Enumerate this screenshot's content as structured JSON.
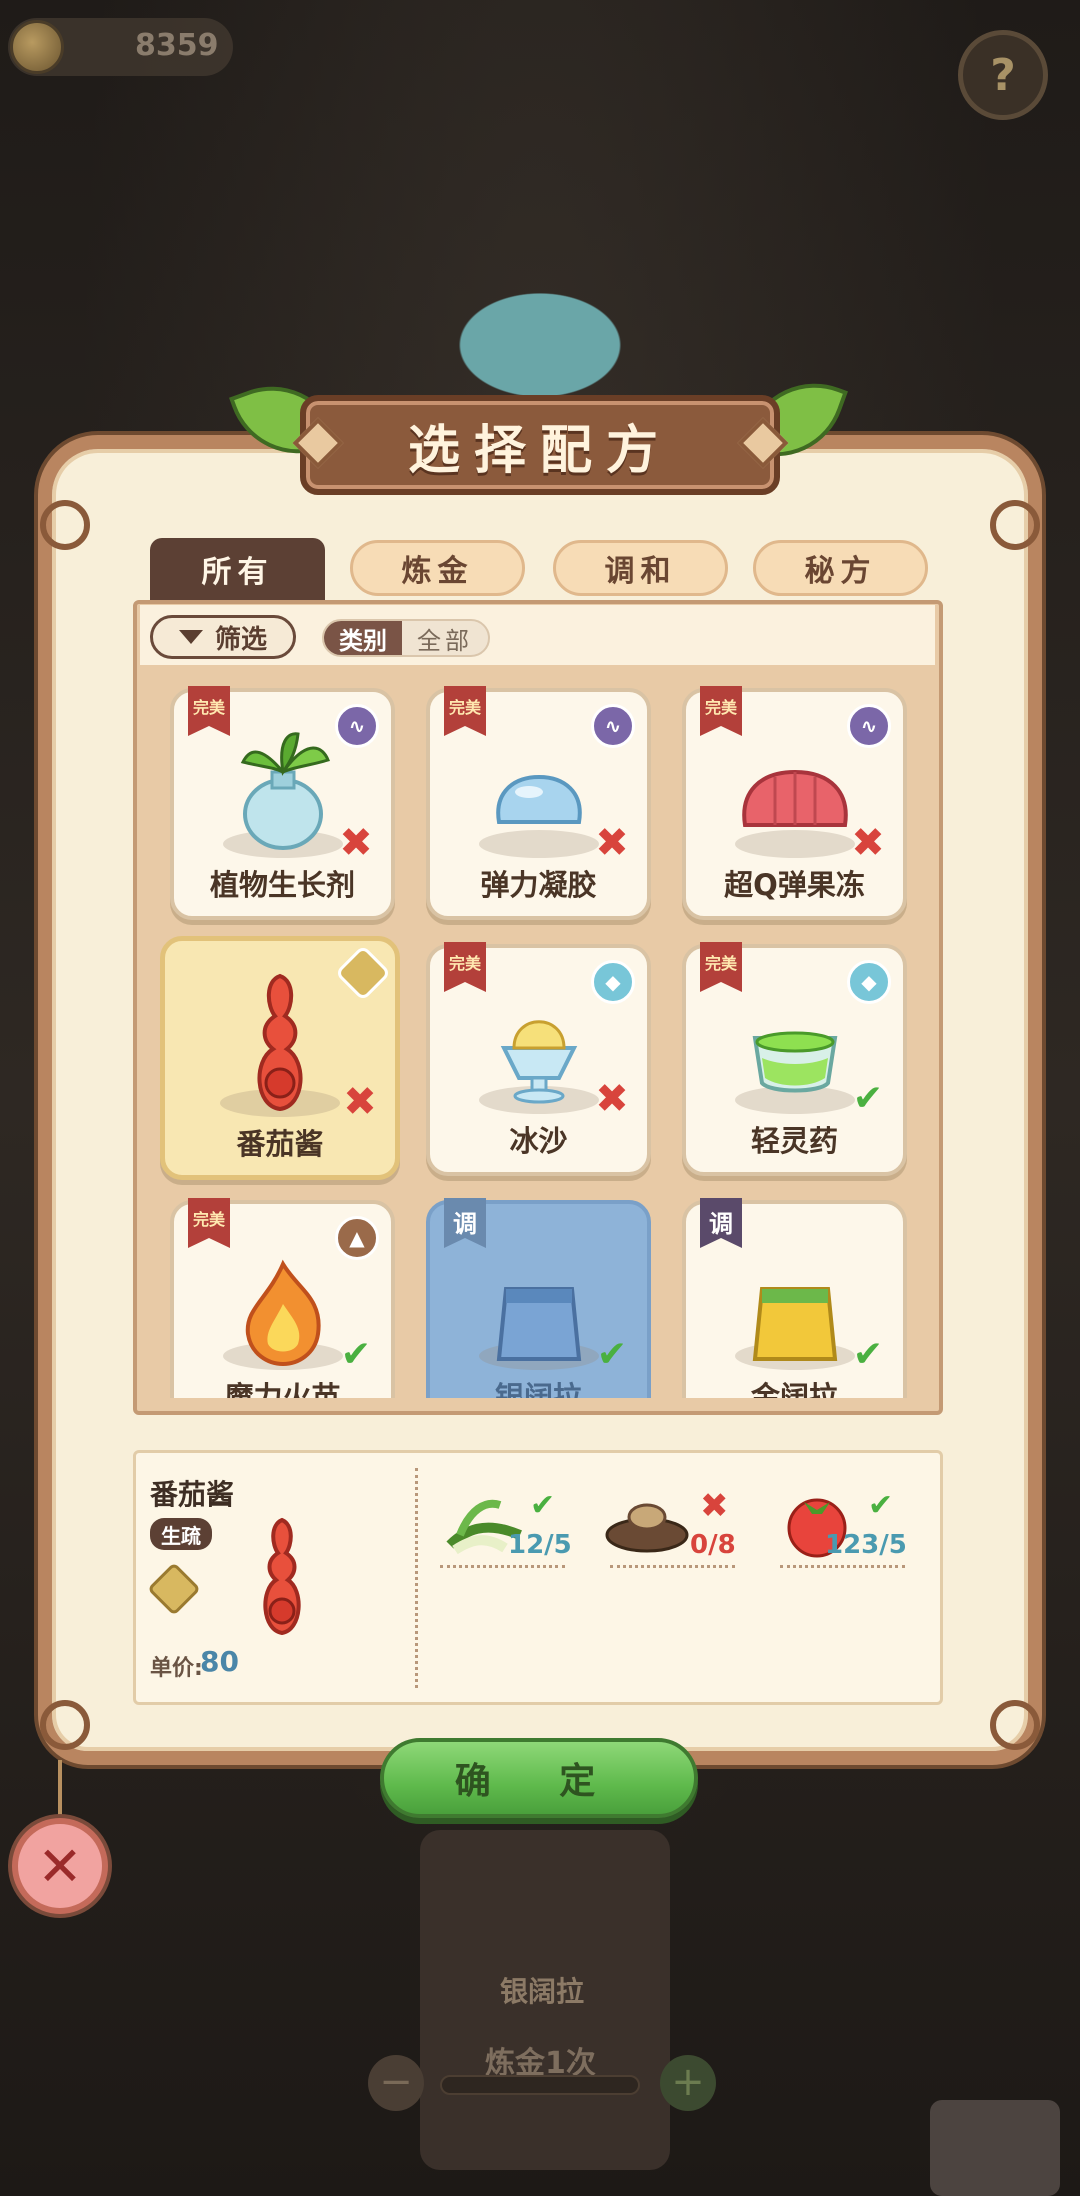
{
  "hud": {
    "coins": "8359",
    "help_icon": "?"
  },
  "panel": {
    "title": "选择配方",
    "tabs": [
      {
        "label": "所有",
        "active": true
      },
      {
        "label": "炼金",
        "active": false
      },
      {
        "label": "调和",
        "active": false
      },
      {
        "label": "秘方",
        "active": false
      }
    ],
    "filter_label": "筛选",
    "category_label": "类别",
    "category_value": "全部"
  },
  "recipes": [
    {
      "name": "植物生长剂",
      "tag": "完美",
      "element": "purple",
      "owned": false
    },
    {
      "name": "弹力凝胶",
      "tag": "完美",
      "element": "purple",
      "owned": false
    },
    {
      "name": "超Q弹果冻",
      "tag": "完美",
      "element": "purple",
      "owned": false
    },
    {
      "name": "番茄酱",
      "tag": "",
      "element": "gold",
      "owned": false,
      "selected": true
    },
    {
      "name": "冰沙",
      "tag": "完美",
      "element": "cyan",
      "owned": false
    },
    {
      "name": "轻灵药",
      "tag": "完美",
      "element": "cyan",
      "owned": true
    },
    {
      "name": "魔力火苗",
      "tag": "完美",
      "element": "brown",
      "owned": true
    },
    {
      "name": "银阔拉",
      "tag": "调",
      "element": "",
      "owned": true,
      "highlight": true
    },
    {
      "name": "金阔拉",
      "tag": "调",
      "element": "",
      "owned": true
    }
  ],
  "detail": {
    "name": "番茄酱",
    "category": "生疏",
    "price_label": "单价:",
    "price": "80",
    "ingredients": [
      {
        "name": "leek",
        "count": "12/5",
        "enough": true
      },
      {
        "name": "mushroom",
        "count": "0/8",
        "enough": false
      },
      {
        "name": "tomato",
        "count": "123/5",
        "enough": true
      }
    ]
  },
  "confirm_label": "确 定",
  "background": {
    "machine_label": "银阔拉",
    "count_label": "炼金1次",
    "minus": "−",
    "plus": "+"
  },
  "colors": {
    "panel_bg": "#f8efd9",
    "panel_border": "#b98560",
    "tab_active": "#5c4034",
    "confirm_green": "#5fba4c",
    "status_bad": "#d8443c",
    "status_ok": "#4ab040",
    "price_blue": "#4a86a8"
  }
}
